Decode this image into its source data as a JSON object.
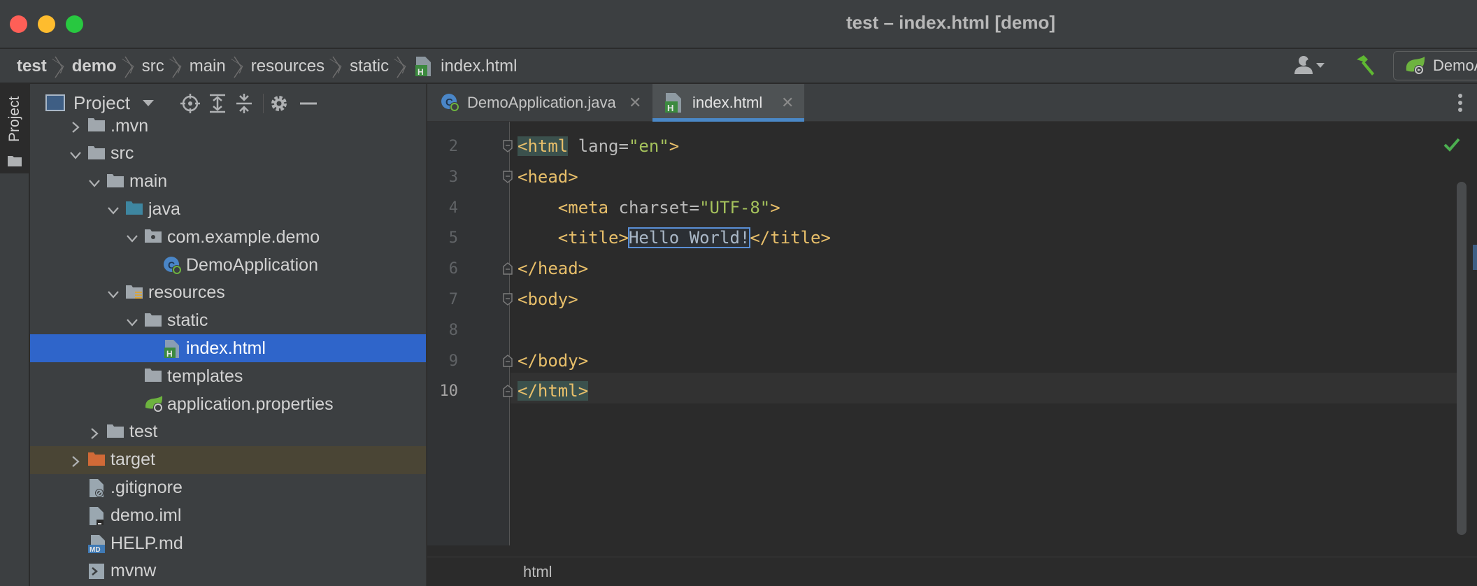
{
  "window": {
    "title": "test – index.html [demo]"
  },
  "breadcrumb": [
    {
      "label": "test",
      "bold": true
    },
    {
      "label": "demo",
      "bold": true
    },
    {
      "label": "src",
      "bold": false
    },
    {
      "label": "main",
      "bold": false
    },
    {
      "label": "resources",
      "bold": false
    },
    {
      "label": "static",
      "bold": false
    },
    {
      "label": "index.html",
      "bold": false
    }
  ],
  "toolbar": {
    "run_config_label": "DemoApplication"
  },
  "stripe": {
    "label": "Project"
  },
  "project_panel": {
    "title": "Project",
    "tree": [
      {
        "label": ".mvn",
        "indent": 1,
        "arrow": "right",
        "icon": "folder-icon"
      },
      {
        "label": "src",
        "indent": 1,
        "arrow": "down",
        "icon": "folder-icon"
      },
      {
        "label": "main",
        "indent": 2,
        "arrow": "down",
        "icon": "folder-icon"
      },
      {
        "label": "java",
        "indent": 3,
        "arrow": "down",
        "icon": "source-folder-icon"
      },
      {
        "label": "com.example.demo",
        "indent": 4,
        "arrow": "down",
        "icon": "package-icon"
      },
      {
        "label": "DemoApplication",
        "indent": 5,
        "arrow": "",
        "icon": "spring-boot-class-icon"
      },
      {
        "label": "resources",
        "indent": 3,
        "arrow": "down",
        "icon": "resources-folder-icon"
      },
      {
        "label": "static",
        "indent": 4,
        "arrow": "down",
        "icon": "folder-icon"
      },
      {
        "label": "index.html",
        "indent": 5,
        "arrow": "",
        "icon": "html-file-icon",
        "selected": true
      },
      {
        "label": "templates",
        "indent": 4,
        "arrow": "",
        "icon": "folder-icon"
      },
      {
        "label": "application.properties",
        "indent": 4,
        "arrow": "",
        "icon": "spring-config-icon"
      },
      {
        "label": "test",
        "indent": 2,
        "arrow": "right",
        "icon": "folder-icon"
      },
      {
        "label": "target",
        "indent": 1,
        "arrow": "right",
        "icon": "excluded-folder-icon",
        "excluded": true
      },
      {
        "label": ".gitignore",
        "indent": 1,
        "arrow": "",
        "icon": "gitignore-file-icon"
      },
      {
        "label": "demo.iml",
        "indent": 1,
        "arrow": "",
        "icon": "iml-file-icon"
      },
      {
        "label": "HELP.md",
        "indent": 1,
        "arrow": "",
        "icon": "markdown-file-icon"
      },
      {
        "label": "mvnw",
        "indent": 1,
        "arrow": "",
        "icon": "shell-script-icon"
      }
    ]
  },
  "editor": {
    "tabs": [
      {
        "label": "DemoApplication.java",
        "active": false,
        "icon": "spring-boot-class-icon"
      },
      {
        "label": "index.html",
        "active": true,
        "icon": "html-file-icon"
      }
    ],
    "line_numbers": [
      "2",
      "3",
      "4",
      "5",
      "6",
      "7",
      "8",
      "9",
      "10"
    ],
    "current_line": "10",
    "code": [
      [
        {
          "t": "<html",
          "c": "tagname hl-tag"
        },
        {
          "t": " lang=",
          "c": "attr"
        },
        {
          "t": "\"en\"",
          "c": "val"
        },
        {
          "t": ">",
          "c": "tagname"
        }
      ],
      [
        {
          "t": "<head>",
          "c": "tagname"
        }
      ],
      [
        {
          "t": "    <meta",
          "c": "tagname"
        },
        {
          "t": " charset=",
          "c": "attr"
        },
        {
          "t": "\"UTF-8\"",
          "c": "val"
        },
        {
          "t": ">",
          "c": "tagname"
        }
      ],
      [
        {
          "t": "    <title>",
          "c": "tagname"
        },
        {
          "t": "Hello World!",
          "c": "txt boxed"
        },
        {
          "t": "</title>",
          "c": "tagname"
        }
      ],
      [
        {
          "t": "</head>",
          "c": "tagname"
        }
      ],
      [
        {
          "t": "<body>",
          "c": "tagname"
        }
      ],
      [],
      [
        {
          "t": "</body>",
          "c": "tagname"
        }
      ],
      [
        {
          "t": "</html>",
          "c": "tagname hl-tag"
        }
      ]
    ],
    "status_breadcrumb": "html"
  },
  "colors": {
    "selection": "#2f65ca",
    "tag": "#e8bf6a",
    "attribute_value": "#a5c25c",
    "active_tab_underline": "#4a88c7",
    "inspection_ok": "#4caf50"
  }
}
